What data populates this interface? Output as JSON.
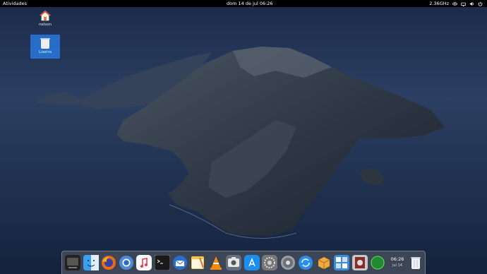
{
  "topbar": {
    "activities": "Atividades",
    "clock": "dom 14 de jul  06:26",
    "cpu": "2.36GHz",
    "tray_icons": [
      "eye-icon",
      "network-icon",
      "volume-icon",
      "power-icon"
    ]
  },
  "desktop": {
    "icons": [
      {
        "label": "nelson",
        "icon": "home-folder-icon"
      },
      {
        "label": "Lixeira",
        "icon": "trash-icon"
      }
    ]
  },
  "dock": {
    "apps": [
      "show-apps-icon",
      "finder-icon",
      "firefox-icon",
      "chromium-icon",
      "music-icon",
      "terminal-icon",
      "thunderbird-icon",
      "notes-icon",
      "vlc-icon",
      "screenshot-icon",
      "app-store-icon",
      "system-preferences-icon",
      "settings-icon",
      "sync-icon",
      "box-icon",
      "utilities-icon",
      "media-icon",
      "green-circle-icon"
    ],
    "clock_time": "06:26",
    "clock_date": "jul 14",
    "trash_icon": "trash-icon"
  }
}
